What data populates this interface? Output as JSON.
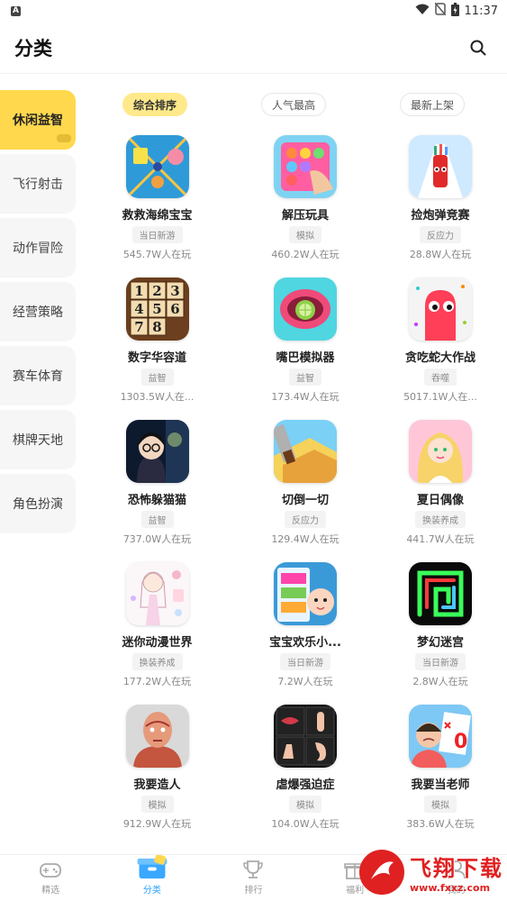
{
  "status_bar": {
    "time": "11:37",
    "app_badge": "A"
  },
  "header": {
    "title": "分类"
  },
  "sidebar": {
    "items": [
      {
        "label": "休闲益智",
        "active": true
      },
      {
        "label": "飞行射击"
      },
      {
        "label": "动作冒险"
      },
      {
        "label": "经营策略"
      },
      {
        "label": "赛车体育"
      },
      {
        "label": "棋牌天地"
      },
      {
        "label": "角色扮演"
      }
    ]
  },
  "sort_tabs": [
    {
      "label": "综合排序",
      "active": true
    },
    {
      "label": "人气最高"
    },
    {
      "label": "最新上架"
    }
  ],
  "games": [
    {
      "name": "救救海绵宝宝",
      "tag": "当日新游",
      "players": "545.7W人在玩",
      "icon": "sponge-rescue-icon"
    },
    {
      "name": "解压玩具",
      "tag": "模拟",
      "players": "460.2W人在玩",
      "icon": "pop-it-toy-icon"
    },
    {
      "name": "捡炮弹竞赛",
      "tag": "反应力",
      "players": "28.8W人在玩",
      "icon": "cannon-race-icon"
    },
    {
      "name": "数字华容道",
      "tag": "益智",
      "players": "1303.5W人在...",
      "icon": "number-puzzle-icon"
    },
    {
      "name": "嘴巴模拟器",
      "tag": "益智",
      "players": "173.4W人在玩",
      "icon": "mouth-simulator-icon"
    },
    {
      "name": "贪吃蛇大作战",
      "tag": "吞噬",
      "players": "5017.1W人在...",
      "icon": "snake-battle-icon"
    },
    {
      "name": "恐怖躲猫猫",
      "tag": "益智",
      "players": "737.0W人在玩",
      "icon": "horror-hide-seek-icon"
    },
    {
      "name": "切倒一切",
      "tag": "反应力",
      "players": "129.4W人在玩",
      "icon": "slice-all-icon"
    },
    {
      "name": "夏日偶像",
      "tag": "换装养成",
      "players": "441.7W人在玩",
      "icon": "summer-idol-icon"
    },
    {
      "name": "迷你动漫世界",
      "tag": "换装养成",
      "players": "177.2W人在玩",
      "icon": "mini-anime-world-icon"
    },
    {
      "name": "宝宝欢乐小...",
      "tag": "当日新游",
      "players": "7.2W人在玩",
      "icon": "baby-fun-icon"
    },
    {
      "name": "梦幻迷宫",
      "tag": "当日新游",
      "players": "2.8W人在玩",
      "icon": "dream-maze-icon"
    },
    {
      "name": "我要造人",
      "tag": "模拟",
      "players": "912.9W人在玩",
      "icon": "make-human-icon"
    },
    {
      "name": "虐爆强迫症",
      "tag": "模拟",
      "players": "104.0W人在玩",
      "icon": "ocd-puzzle-icon"
    },
    {
      "name": "我要当老师",
      "tag": "模拟",
      "players": "383.6W人在玩",
      "icon": "be-teacher-icon"
    }
  ],
  "bottom_nav": [
    {
      "label": "精选",
      "icon": "gamepad-icon"
    },
    {
      "label": "分类",
      "icon": "category-box-icon",
      "active": true
    },
    {
      "label": "排行",
      "icon": "trophy-icon"
    },
    {
      "label": "福利",
      "icon": "gift-icon"
    },
    {
      "label": "我的",
      "icon": "user-icon"
    }
  ],
  "watermark": {
    "title": "飞翔下载",
    "url": "www.fxxz.com"
  },
  "colors": {
    "accent_yellow": "#ffd84d",
    "nav_active": "#2aa3ff",
    "watermark_red": "#e02121"
  }
}
